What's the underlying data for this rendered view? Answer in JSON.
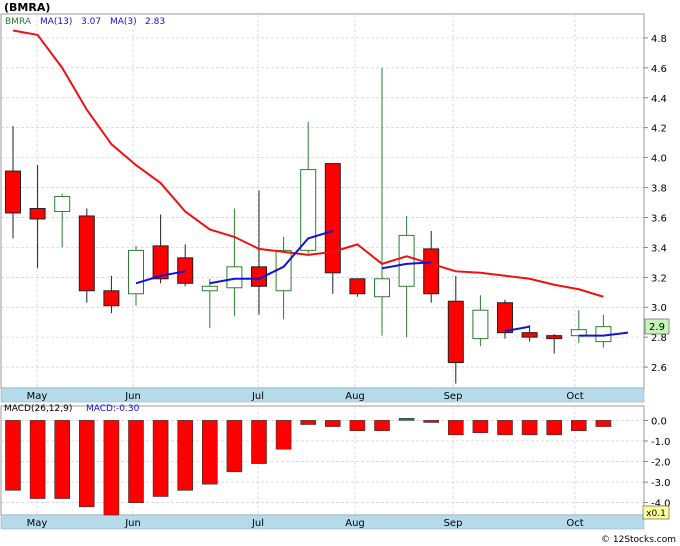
{
  "title": "(BMRA)",
  "legend": {
    "ticker": "BMRA",
    "ma13_label": "MA(13)",
    "ma13_value": "3.07",
    "ma3_label": "MA(3)",
    "ma3_value": "2.83"
  },
  "macd_legend": {
    "label": "MACD(26,12,9)",
    "value_label": "MACD:-0.30"
  },
  "last_price_badge": "2.9",
  "macd_scale_badge": "x0.1",
  "footer": "© 12Stocks.com",
  "colors": {
    "up_candle": "#2e7d32",
    "down_candle": "#ff0000",
    "ma13": "#ee1111",
    "ma3": "#1111dd",
    "band": "#b5dbea",
    "grid": "#c8c8c8",
    "badge": "#c6f5b8"
  },
  "chart_data": [
    {
      "type": "candlestick",
      "title": "(BMRA)",
      "period": "weekly",
      "ylim": [
        2.46,
        4.96
      ],
      "y_ticks": [
        "2.6",
        "2.8",
        "3.0",
        "3.2",
        "3.4",
        "3.6",
        "3.8",
        "4.0",
        "4.2",
        "4.4",
        "4.6",
        "4.8"
      ],
      "x_ticks": [
        "May",
        "Jun",
        "Jul",
        "Aug",
        "Sep",
        "Oct"
      ],
      "candles": [
        {
          "open": 3.91,
          "high": 4.21,
          "low": 3.46,
          "close": 3.63
        },
        {
          "open": 3.66,
          "high": 3.95,
          "low": 3.26,
          "close": 3.59
        },
        {
          "open": 3.64,
          "high": 3.76,
          "low": 3.4,
          "close": 3.74
        },
        {
          "open": 3.61,
          "high": 3.66,
          "low": 3.03,
          "close": 3.11
        },
        {
          "open": 3.11,
          "high": 3.21,
          "low": 2.96,
          "close": 3.01
        },
        {
          "open": 3.09,
          "high": 3.41,
          "low": 3.01,
          "close": 3.38
        },
        {
          "open": 3.41,
          "high": 3.62,
          "low": 3.16,
          "close": 3.19
        },
        {
          "open": 3.33,
          "high": 3.42,
          "low": 3.14,
          "close": 3.16
        },
        {
          "open": 3.11,
          "high": 3.19,
          "low": 2.86,
          "close": 3.14
        },
        {
          "open": 3.13,
          "high": 3.66,
          "low": 2.94,
          "close": 3.27
        },
        {
          "open": 3.27,
          "high": 3.78,
          "low": 2.95,
          "close": 3.14
        },
        {
          "open": 3.11,
          "high": 3.47,
          "low": 2.92,
          "close": 3.38
        },
        {
          "open": 3.38,
          "high": 4.24,
          "low": 3.36,
          "close": 3.92
        },
        {
          "open": 3.96,
          "high": 3.96,
          "low": 3.09,
          "close": 3.23
        },
        {
          "open": 3.19,
          "high": 3.19,
          "low": 3.07,
          "close": 3.09
        },
        {
          "open": 3.07,
          "high": 4.6,
          "low": 2.81,
          "close": 3.19
        },
        {
          "open": 3.14,
          "high": 3.61,
          "low": 2.8,
          "close": 3.48
        },
        {
          "open": 3.39,
          "high": 3.51,
          "low": 3.03,
          "close": 3.09
        },
        {
          "open": 3.04,
          "high": 3.21,
          "low": 2.49,
          "close": 2.63
        },
        {
          "open": 2.79,
          "high": 3.08,
          "low": 2.74,
          "close": 2.98
        },
        {
          "open": 3.03,
          "high": 3.05,
          "low": 2.79,
          "close": 2.83
        },
        {
          "open": 2.83,
          "high": 2.88,
          "low": 2.77,
          "close": 2.8
        },
        {
          "open": 2.81,
          "high": 2.82,
          "low": 2.69,
          "close": 2.79
        },
        {
          "open": 2.81,
          "high": 2.98,
          "low": 2.76,
          "close": 2.85
        },
        {
          "open": 2.77,
          "high": 2.95,
          "low": 2.73,
          "close": 2.87
        }
      ],
      "ma13": [
        4.85,
        4.82,
        4.6,
        4.32,
        4.09,
        3.95,
        3.83,
        3.64,
        3.52,
        3.47,
        3.39,
        3.37,
        3.35,
        3.37,
        3.42,
        3.29,
        3.34,
        3.29,
        3.24,
        3.23,
        3.21,
        3.19,
        3.15,
        3.12,
        3.07
      ],
      "ma3_segments": [
        {
          "start": 5,
          "values": [
            3.16,
            3.21,
            3.24
          ]
        },
        {
          "start": 8,
          "values": [
            3.16,
            3.19,
            3.19
          ]
        },
        {
          "start": 10,
          "values": [
            3.19,
            3.27,
            3.46,
            3.51
          ]
        },
        {
          "start": 15,
          "values": [
            3.26,
            3.29,
            3.3
          ]
        },
        {
          "start": 20,
          "values": [
            2.84,
            2.87
          ]
        },
        {
          "start": 23,
          "values": [
            2.81,
            2.81,
            2.83
          ]
        }
      ]
    },
    {
      "type": "bar",
      "title": "MACD(26,12,9)",
      "ylim": [
        -4.6,
        0.7
      ],
      "y_ticks": [
        "0.0",
        "-1.0",
        "-2.0",
        "-3.0",
        "-4.0"
      ],
      "x_ticks": [
        "May",
        "Jun",
        "Jul",
        "Aug",
        "Sep",
        "Oct"
      ],
      "values": [
        -3.4,
        -3.8,
        -3.8,
        -4.2,
        -4.6,
        -4.0,
        -3.7,
        -3.4,
        -3.1,
        -2.5,
        -2.1,
        -1.4,
        -0.2,
        -0.3,
        -0.5,
        -0.5,
        0.1,
        -0.1,
        -0.7,
        -0.6,
        -0.7,
        -0.7,
        -0.7,
        -0.5,
        -0.3
      ]
    }
  ]
}
